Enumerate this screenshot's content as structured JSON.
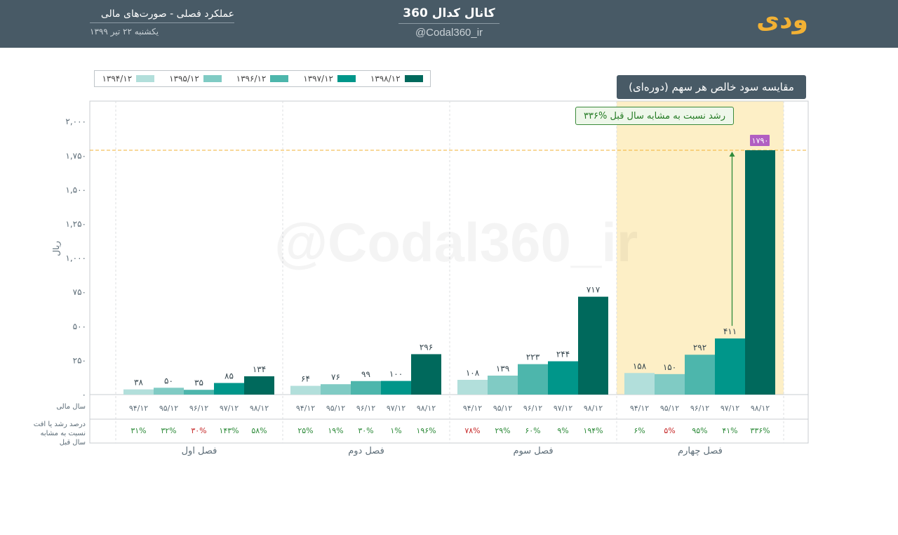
{
  "header": {
    "subtitle": "عملکرد فصلی - صورت‌های مالی",
    "date": "یکشنبه ۲۲ تیر ۱۳۹۹",
    "channel_title": "کانال کدال 360",
    "channel_handle": "@Codal360_ir",
    "symbol": "ودی"
  },
  "watermark": "@Codal360_ir",
  "colors": {
    "header_bg": "#485a66",
    "symbol": "#f2b134",
    "highlight_bg": "#fdefc6",
    "ref_line": "#f2b134",
    "growth_positive": "#2e8b3a",
    "growth_negative": "#c62828",
    "arrow": "#2e8b3a",
    "last_value_badge": "#b15fc2"
  },
  "chart_data": {
    "type": "bar",
    "title": "مقایسه سود خالص هر سهم (دوره‌ای)",
    "ylabel": "ریال",
    "ylim": [
      0,
      2150
    ],
    "yticks": [
      0,
      250,
      500,
      750,
      1000,
      1250,
      1500,
      1750,
      2000
    ],
    "ytick_labels": [
      "۰",
      "۲۵۰",
      "۵۰۰",
      "۷۵۰",
      "۱,۰۰۰",
      "۱,۲۵۰",
      "۱,۵۰۰",
      "۱,۷۵۰",
      "۲,۰۰۰"
    ],
    "legend_position": "top-left",
    "categories": [
      "فصل اول",
      "فصل دوم",
      "فصل سوم",
      "فصل چهارم"
    ],
    "row_labels": {
      "year": "سال مالی",
      "growth": [
        "درصد رشد یا افت",
        "نسبت به مشابه",
        "سال قبل"
      ]
    },
    "series": [
      {
        "name": "۱۳۹۴/۱۲",
        "short": "۹۴/۱۲",
        "color": "#b2dfdb",
        "values": [
          38,
          64,
          108,
          158
        ],
        "labels": [
          "۳۸",
          "۶۴",
          "۱۰۸",
          "۱۵۸"
        ]
      },
      {
        "name": "۱۳۹۵/۱۲",
        "short": "۹۵/۱۲",
        "color": "#80cbc4",
        "values": [
          50,
          76,
          139,
          150
        ],
        "labels": [
          "۵۰",
          "۷۶",
          "۱۳۹",
          "۱۵۰"
        ]
      },
      {
        "name": "۱۳۹۶/۱۲",
        "short": "۹۶/۱۲",
        "color": "#4db6ac",
        "values": [
          35,
          99,
          223,
          292
        ],
        "labels": [
          "۳۵",
          "۹۹",
          "۲۲۳",
          "۲۹۲"
        ]
      },
      {
        "name": "۱۳۹۷/۱۲",
        "short": "۹۷/۱۲",
        "color": "#00968a",
        "values": [
          85,
          100,
          244,
          411
        ],
        "labels": [
          "۸۵",
          "۱۰۰",
          "۲۴۴",
          "۴۱۱"
        ]
      },
      {
        "name": "۱۳۹۸/۱۲",
        "short": "۹۸/۱۲",
        "color": "#00695c",
        "values": [
          134,
          296,
          717,
          1790
        ],
        "labels": [
          "۱۳۴",
          "۲۹۶",
          "۷۱۷",
          "۱۷۹۰"
        ]
      }
    ],
    "growth": [
      [
        {
          "t": "۳۱%",
          "pos": true
        },
        {
          "t": "۳۲%",
          "pos": true
        },
        {
          "t": "۳۰%",
          "pos": false
        },
        {
          "t": "۱۴۳%",
          "pos": true
        },
        {
          "t": "۵۸%",
          "pos": true
        }
      ],
      [
        {
          "t": "۲۵%",
          "pos": true
        },
        {
          "t": "۱۹%",
          "pos": true
        },
        {
          "t": "۳۰%",
          "pos": true
        },
        {
          "t": "۱%",
          "pos": true
        },
        {
          "t": "۱۹۶%",
          "pos": true
        }
      ],
      [
        {
          "t": "۷۸%",
          "pos": false
        },
        {
          "t": "۲۹%",
          "pos": true
        },
        {
          "t": "۶۰%",
          "pos": true
        },
        {
          "t": "۹%",
          "pos": true
        },
        {
          "t": "۱۹۴%",
          "pos": true
        }
      ],
      [
        {
          "t": "۶%",
          "pos": true
        },
        {
          "t": "۵%",
          "pos": false
        },
        {
          "t": "۹۵%",
          "pos": true
        },
        {
          "t": "۴۱%",
          "pos": true
        },
        {
          "t": "۳۳۶%",
          "pos": true
        }
      ]
    ],
    "highlight_category": 3,
    "reference_value": 1790,
    "annotation": "۳۳۶% رشد نسبت به مشابه سال قبل"
  }
}
